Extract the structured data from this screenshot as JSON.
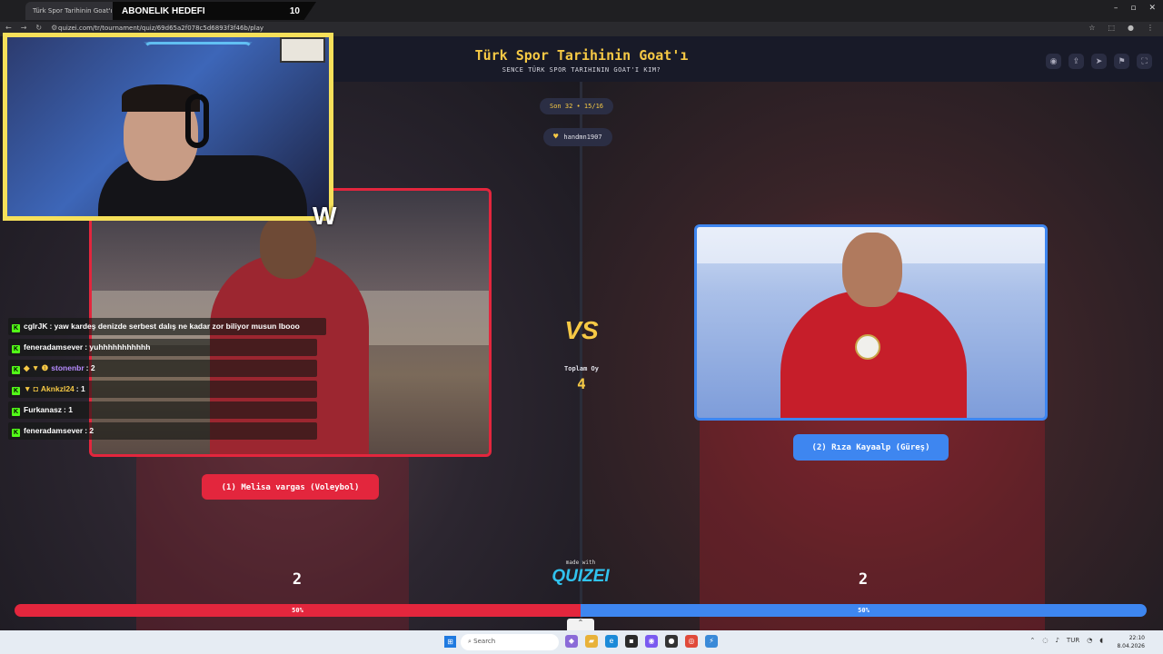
{
  "browser": {
    "tab_title": "Türk Spor Tarihinin Goat'ı - Tie",
    "url": "quizei.com/tr/tournament/quiz/69d65a2f078c5d6893f3f46b/play",
    "tab_count": "0"
  },
  "stream_banner": {
    "label": "ABONELIK HEDEFI",
    "value": "10"
  },
  "header": {
    "title": "Türk Spor Tarihinin Goat'ı",
    "subtitle": "SENCE TÜRK SPOR TARIHININ GOAT'I KIM?"
  },
  "round": {
    "label": "Son 32 • 15/16"
  },
  "creator": {
    "name": "handmn1907",
    "icon": "heart-icon"
  },
  "vs": {
    "label": "VS",
    "total_label": "Toplam Oy",
    "total_value": "4"
  },
  "contestants": [
    {
      "label": "(1) Melisa vargas (Voleybol)",
      "votes": "2",
      "percent_label": "50%",
      "percent": 50,
      "color": "#e3263d"
    },
    {
      "label": "(2) Rıza Kayaalp (Güreş)",
      "votes": "2",
      "percent_label": "50%",
      "percent": 50,
      "color": "#3e86f0"
    }
  ],
  "footer": {
    "made_with": "made with",
    "brand": "QUIZEI"
  },
  "chat": [
    {
      "user": "cglrJK",
      "text": ": yaw kardeş denizde serbest dalış ne kadar zor biliyor musun lbooo",
      "user_color": "#ffffff",
      "extra": ""
    },
    {
      "user": "feneradamsever",
      "text": ": yuhhhhhhhhhhh",
      "user_color": "#ffffff",
      "extra": ""
    },
    {
      "user": "stonenbr",
      "text": ": 2",
      "user_color": "#b78cff",
      "extra": "◆ ▼ ❶"
    },
    {
      "user": "Aknkzl24",
      "text": ": 1",
      "user_color": "#f6c945",
      "extra": "▼ ◘"
    },
    {
      "user": "Furkanasz",
      "text": ": 1",
      "user_color": "#ffffff",
      "extra": ""
    },
    {
      "user": "feneradamsever",
      "text": ": 2",
      "user_color": "#ffffff",
      "extra": ""
    }
  ],
  "taskbar": {
    "search_placeholder": "Search",
    "lang": "TUR",
    "time": "22:10",
    "date": "8.04.2026"
  }
}
